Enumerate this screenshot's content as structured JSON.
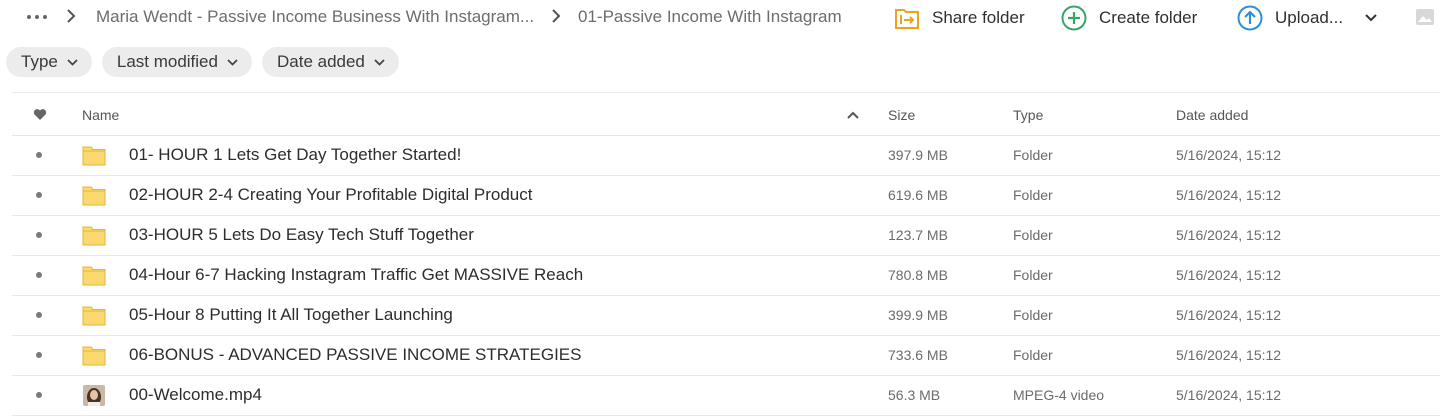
{
  "breadcrumb": {
    "items": [
      "Maria Wendt - Passive Income Business With Instagram...",
      "01-Passive Income With Instagram"
    ]
  },
  "actions": {
    "share": {
      "label": "Share folder",
      "icon": "share-folder-icon",
      "color": "#f0a31a"
    },
    "create": {
      "label": "Create folder",
      "icon": "create-folder-icon",
      "color": "#3aa36a"
    },
    "upload": {
      "label": "Upload...",
      "icon": "upload-icon",
      "color": "#2e8fd8"
    }
  },
  "filters": [
    {
      "label": "Type"
    },
    {
      "label": "Last modified"
    },
    {
      "label": "Date added"
    }
  ],
  "table": {
    "columns": {
      "favorite_icon": "heart-icon",
      "name": "Name",
      "size": "Size",
      "type": "Type",
      "date_added": "Date added"
    },
    "rows": [
      {
        "name": "01- HOUR 1 Lets Get Day Together Started!",
        "size": "397.9 MB",
        "type": "Folder",
        "date": "5/16/2024, 15:12",
        "icon": "folder-icon"
      },
      {
        "name": "02-HOUR 2-4 Creating Your Profitable Digital Product",
        "size": "619.6 MB",
        "type": "Folder",
        "date": "5/16/2024, 15:12",
        "icon": "folder-icon"
      },
      {
        "name": "03-HOUR 5 Lets Do Easy Tech Stuff Together",
        "size": "123.7 MB",
        "type": "Folder",
        "date": "5/16/2024, 15:12",
        "icon": "folder-icon"
      },
      {
        "name": "04-Hour 6-7 Hacking Instagram Traffic Get MASSIVE Reach",
        "size": "780.8 MB",
        "type": "Folder",
        "date": "5/16/2024, 15:12",
        "icon": "folder-icon"
      },
      {
        "name": "05-Hour 8 Putting It All Together Launching",
        "size": "399.9 MB",
        "type": "Folder",
        "date": "5/16/2024, 15:12",
        "icon": "folder-icon"
      },
      {
        "name": "06-BONUS - ADVANCED PASSIVE INCOME STRATEGIES",
        "size": "733.6 MB",
        "type": "Folder",
        "date": "5/16/2024, 15:12",
        "icon": "folder-icon"
      },
      {
        "name": "00-Welcome.mp4",
        "size": "56.3 MB",
        "type": "MPEG-4 video",
        "date": "5/16/2024, 15:12",
        "icon": "video-thumbnail"
      }
    ]
  },
  "colors": {
    "folder": "#f9cf5a",
    "chip_bg": "#ececec"
  }
}
